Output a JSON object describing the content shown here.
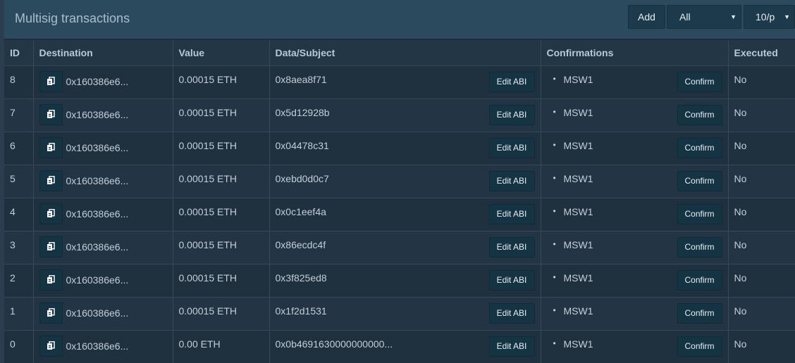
{
  "header": {
    "title": "Multisig transactions",
    "add_label": "Add",
    "filter_value": "All",
    "page_size_value": "10/p"
  },
  "columns": {
    "id": "ID",
    "destination": "Destination",
    "value": "Value",
    "data": "Data/Subject",
    "confirmations": "Confirmations",
    "executed": "Executed"
  },
  "labels": {
    "edit_abi": "Edit ABI",
    "confirm": "Confirm"
  },
  "icons": {
    "copy": "copy-icon"
  },
  "rows": [
    {
      "id": "8",
      "destination": "0x160386e6...",
      "value": "0.00015 ETH",
      "data": "0x8aea8f71",
      "confirmations": [
        "MSW1"
      ],
      "executed": "No"
    },
    {
      "id": "7",
      "destination": "0x160386e6...",
      "value": "0.00015 ETH",
      "data": "0x5d12928b",
      "confirmations": [
        "MSW1"
      ],
      "executed": "No"
    },
    {
      "id": "6",
      "destination": "0x160386e6...",
      "value": "0.00015 ETH",
      "data": "0x04478c31",
      "confirmations": [
        "MSW1"
      ],
      "executed": "No"
    },
    {
      "id": "5",
      "destination": "0x160386e6...",
      "value": "0.00015 ETH",
      "data": "0xebd0d0c7",
      "confirmations": [
        "MSW1"
      ],
      "executed": "No"
    },
    {
      "id": "4",
      "destination": "0x160386e6...",
      "value": "0.00015 ETH",
      "data": "0x0c1eef4a",
      "confirmations": [
        "MSW1"
      ],
      "executed": "No"
    },
    {
      "id": "3",
      "destination": "0x160386e6...",
      "value": "0.00015 ETH",
      "data": "0x86ecdc4f",
      "confirmations": [
        "MSW1"
      ],
      "executed": "No"
    },
    {
      "id": "2",
      "destination": "0x160386e6...",
      "value": "0.00015 ETH",
      "data": "0x3f825ed8",
      "confirmations": [
        "MSW1"
      ],
      "executed": "No"
    },
    {
      "id": "1",
      "destination": "0x160386e6...",
      "value": "0.00015 ETH",
      "data": "0x1f2d1531",
      "confirmations": [
        "MSW1"
      ],
      "executed": "No"
    },
    {
      "id": "0",
      "destination": "0x160386e6...",
      "value": "0.00 ETH",
      "data": "0x0b4691630000000000...",
      "confirmations": [
        "MSW1"
      ],
      "executed": "No"
    }
  ]
}
